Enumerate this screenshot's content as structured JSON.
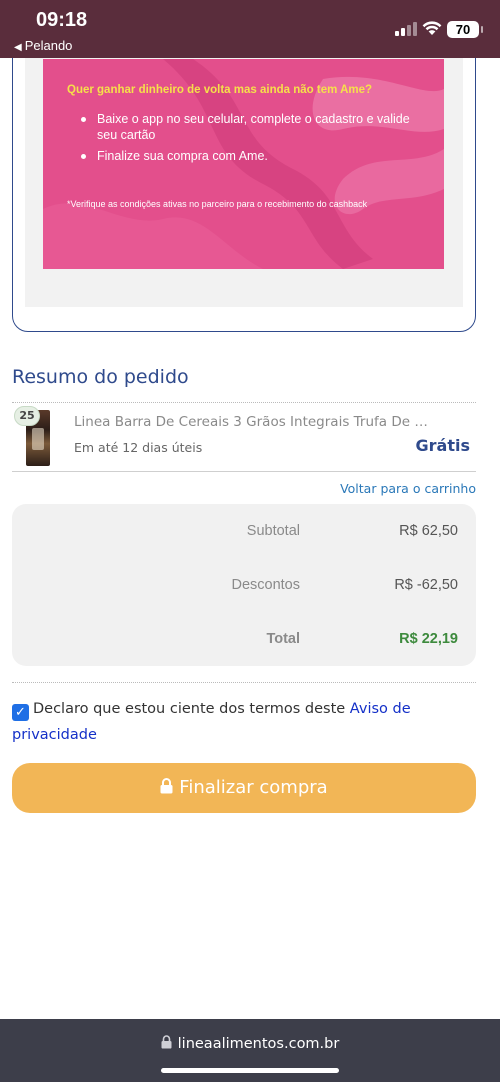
{
  "status_bar": {
    "time": "09:18",
    "back_app": "Pelando",
    "battery": "70"
  },
  "ame_promo": {
    "title": "Quer ganhar dinheiro de volta mas ainda não tem Ame?",
    "steps": [
      "Baixe o app no seu celular, complete o cadastro e valide seu cartão",
      "Finalize sua compra com Ame."
    ],
    "note": "*Verifique as condições ativas no parceiro para o recebimento do cashback",
    "colors": {
      "banner": "#e34f8c",
      "title": "#f6e04a"
    }
  },
  "summary": {
    "title": "Resumo do pedido",
    "item": {
      "quantity": "25",
      "name": "Linea Barra De Cereais 3 Grãos Integrais Trufa De Ch...",
      "delivery": "Em até 12 dias úteis",
      "shipping_price": "Grátis"
    },
    "back_to_cart": "Voltar para o carrinho",
    "totals": {
      "subtotal_label": "Subtotal",
      "subtotal_value": "R$ 62,50",
      "discount_label": "Descontos",
      "discount_value": "R$ -62,50",
      "total_label": "Total",
      "total_value": "R$ 22,19"
    }
  },
  "consent": {
    "checked": true,
    "text": "Declaro que estou ciente dos termos deste ",
    "link": "Aviso de privacidade"
  },
  "checkout": {
    "button_label": "Finalizar compra",
    "color": "#f2b656"
  },
  "browser": {
    "url": "lineaalimentos.com.br"
  }
}
